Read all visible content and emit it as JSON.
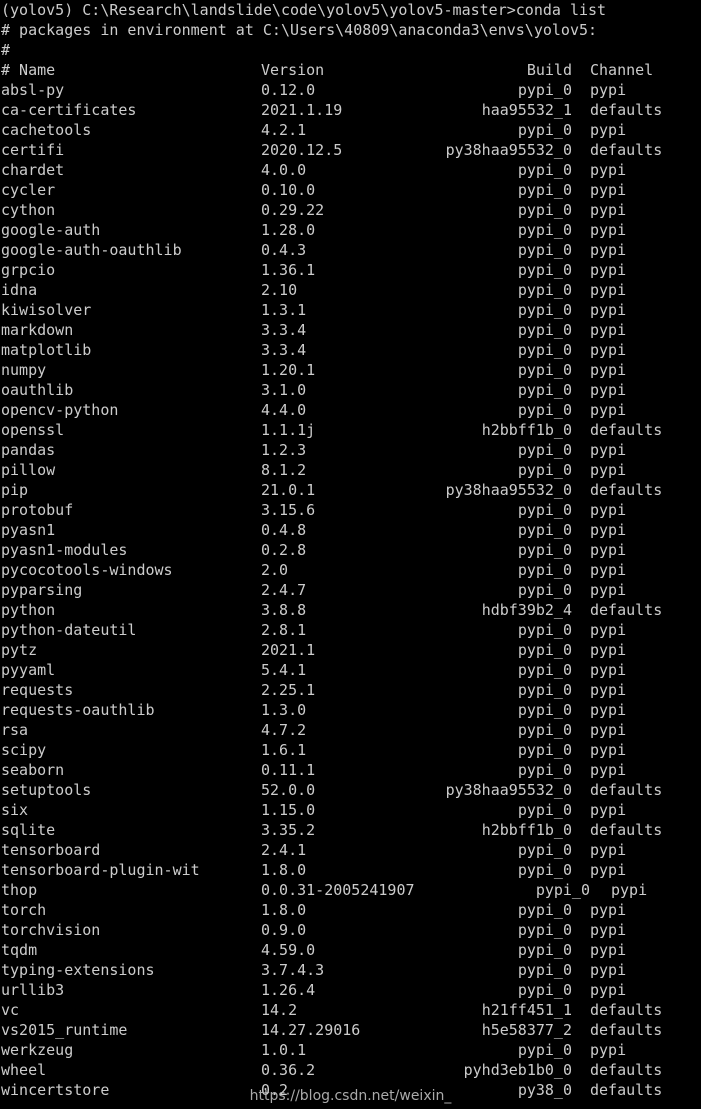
{
  "terminal": {
    "title": "conda list",
    "background_color": "#000000",
    "text_color": "#cccccc",
    "prompt_line": "(yolov5) C:\\Research\\landslide\\code\\yolov5\\yolov5-master>conda list",
    "comment_lines": [
      "# packages in environment at C:\\Users\\40809\\anaconda3\\envs\\yolov5:",
      "#"
    ],
    "header": {
      "name": "# Name",
      "version": "Version",
      "build": "Build",
      "channel": "Channel"
    },
    "packages": [
      {
        "name": "absl-py",
        "version": "0.12.0",
        "build": "pypi_0",
        "channel": "pypi"
      },
      {
        "name": "ca-certificates",
        "version": "2021.1.19",
        "build": "haa95532_1",
        "channel": "defaults"
      },
      {
        "name": "cachetools",
        "version": "4.2.1",
        "build": "pypi_0",
        "channel": "pypi"
      },
      {
        "name": "certifi",
        "version": "2020.12.5",
        "build": "py38haa95532_0",
        "channel": "defaults"
      },
      {
        "name": "chardet",
        "version": "4.0.0",
        "build": "pypi_0",
        "channel": "pypi"
      },
      {
        "name": "cycler",
        "version": "0.10.0",
        "build": "pypi_0",
        "channel": "pypi"
      },
      {
        "name": "cython",
        "version": "0.29.22",
        "build": "pypi_0",
        "channel": "pypi"
      },
      {
        "name": "google-auth",
        "version": "1.28.0",
        "build": "pypi_0",
        "channel": "pypi"
      },
      {
        "name": "google-auth-oauthlib",
        "version": "0.4.3",
        "build": "pypi_0",
        "channel": "pypi"
      },
      {
        "name": "grpcio",
        "version": "1.36.1",
        "build": "pypi_0",
        "channel": "pypi"
      },
      {
        "name": "idna",
        "version": "2.10",
        "build": "pypi_0",
        "channel": "pypi"
      },
      {
        "name": "kiwisolver",
        "version": "1.3.1",
        "build": "pypi_0",
        "channel": "pypi"
      },
      {
        "name": "markdown",
        "version": "3.3.4",
        "build": "pypi_0",
        "channel": "pypi"
      },
      {
        "name": "matplotlib",
        "version": "3.3.4",
        "build": "pypi_0",
        "channel": "pypi"
      },
      {
        "name": "numpy",
        "version": "1.20.1",
        "build": "pypi_0",
        "channel": "pypi"
      },
      {
        "name": "oauthlib",
        "version": "3.1.0",
        "build": "pypi_0",
        "channel": "pypi"
      },
      {
        "name": "opencv-python",
        "version": "4.4.0",
        "build": "pypi_0",
        "channel": "pypi"
      },
      {
        "name": "openssl",
        "version": "1.1.1j",
        "build": "h2bbff1b_0",
        "channel": "defaults"
      },
      {
        "name": "pandas",
        "version": "1.2.3",
        "build": "pypi_0",
        "channel": "pypi"
      },
      {
        "name": "pillow",
        "version": "8.1.2",
        "build": "pypi_0",
        "channel": "pypi"
      },
      {
        "name": "pip",
        "version": "21.0.1",
        "build": "py38haa95532_0",
        "channel": "defaults"
      },
      {
        "name": "protobuf",
        "version": "3.15.6",
        "build": "pypi_0",
        "channel": "pypi"
      },
      {
        "name": "pyasn1",
        "version": "0.4.8",
        "build": "pypi_0",
        "channel": "pypi"
      },
      {
        "name": "pyasn1-modules",
        "version": "0.2.8",
        "build": "pypi_0",
        "channel": "pypi"
      },
      {
        "name": "pycocotools-windows",
        "version": "2.0",
        "build": "pypi_0",
        "channel": "pypi"
      },
      {
        "name": "pyparsing",
        "version": "2.4.7",
        "build": "pypi_0",
        "channel": "pypi"
      },
      {
        "name": "python",
        "version": "3.8.8",
        "build": "hdbf39b2_4",
        "channel": "defaults"
      },
      {
        "name": "python-dateutil",
        "version": "2.8.1",
        "build": "pypi_0",
        "channel": "pypi"
      },
      {
        "name": "pytz",
        "version": "2021.1",
        "build": "pypi_0",
        "channel": "pypi"
      },
      {
        "name": "pyyaml",
        "version": "5.4.1",
        "build": "pypi_0",
        "channel": "pypi"
      },
      {
        "name": "requests",
        "version": "2.25.1",
        "build": "pypi_0",
        "channel": "pypi"
      },
      {
        "name": "requests-oauthlib",
        "version": "1.3.0",
        "build": "pypi_0",
        "channel": "pypi"
      },
      {
        "name": "rsa",
        "version": "4.7.2",
        "build": "pypi_0",
        "channel": "pypi"
      },
      {
        "name": "scipy",
        "version": "1.6.1",
        "build": "pypi_0",
        "channel": "pypi"
      },
      {
        "name": "seaborn",
        "version": "0.11.1",
        "build": "pypi_0",
        "channel": "pypi"
      },
      {
        "name": "setuptools",
        "version": "52.0.0",
        "build": "py38haa95532_0",
        "channel": "defaults"
      },
      {
        "name": "six",
        "version": "1.15.0",
        "build": "pypi_0",
        "channel": "pypi"
      },
      {
        "name": "sqlite",
        "version": "3.35.2",
        "build": "h2bbff1b_0",
        "channel": "defaults"
      },
      {
        "name": "tensorboard",
        "version": "2.4.1",
        "build": "pypi_0",
        "channel": "pypi"
      },
      {
        "name": "tensorboard-plugin-wit",
        "version": "1.8.0",
        "build": "pypi_0",
        "channel": "pypi"
      },
      {
        "name": "thop",
        "version": "0.0.31-2005241907",
        "build": "pypi_0",
        "channel": "pypi",
        "shifted": true
      },
      {
        "name": "torch",
        "version": "1.8.0",
        "build": "pypi_0",
        "channel": "pypi"
      },
      {
        "name": "torchvision",
        "version": "0.9.0",
        "build": "pypi_0",
        "channel": "pypi"
      },
      {
        "name": "tqdm",
        "version": "4.59.0",
        "build": "pypi_0",
        "channel": "pypi"
      },
      {
        "name": "typing-extensions",
        "version": "3.7.4.3",
        "build": "pypi_0",
        "channel": "pypi"
      },
      {
        "name": "urllib3",
        "version": "1.26.4",
        "build": "pypi_0",
        "channel": "pypi"
      },
      {
        "name": "vc",
        "version": "14.2",
        "build": "h21ff451_1",
        "channel": "defaults"
      },
      {
        "name": "vs2015_runtime",
        "version": "14.27.29016",
        "build": "h5e58377_2",
        "channel": "defaults"
      },
      {
        "name": "werkzeug",
        "version": "1.0.1",
        "build": "pypi_0",
        "channel": "pypi"
      },
      {
        "name": "wheel",
        "version": "0.36.2",
        "build": "pyhd3eb1b0_0",
        "channel": "defaults"
      },
      {
        "name": "wincertstore",
        "version": "0.2",
        "build": "py38_0",
        "channel": "defaults"
      }
    ],
    "watermark": "https://blog.csdn.net/weixin_"
  }
}
